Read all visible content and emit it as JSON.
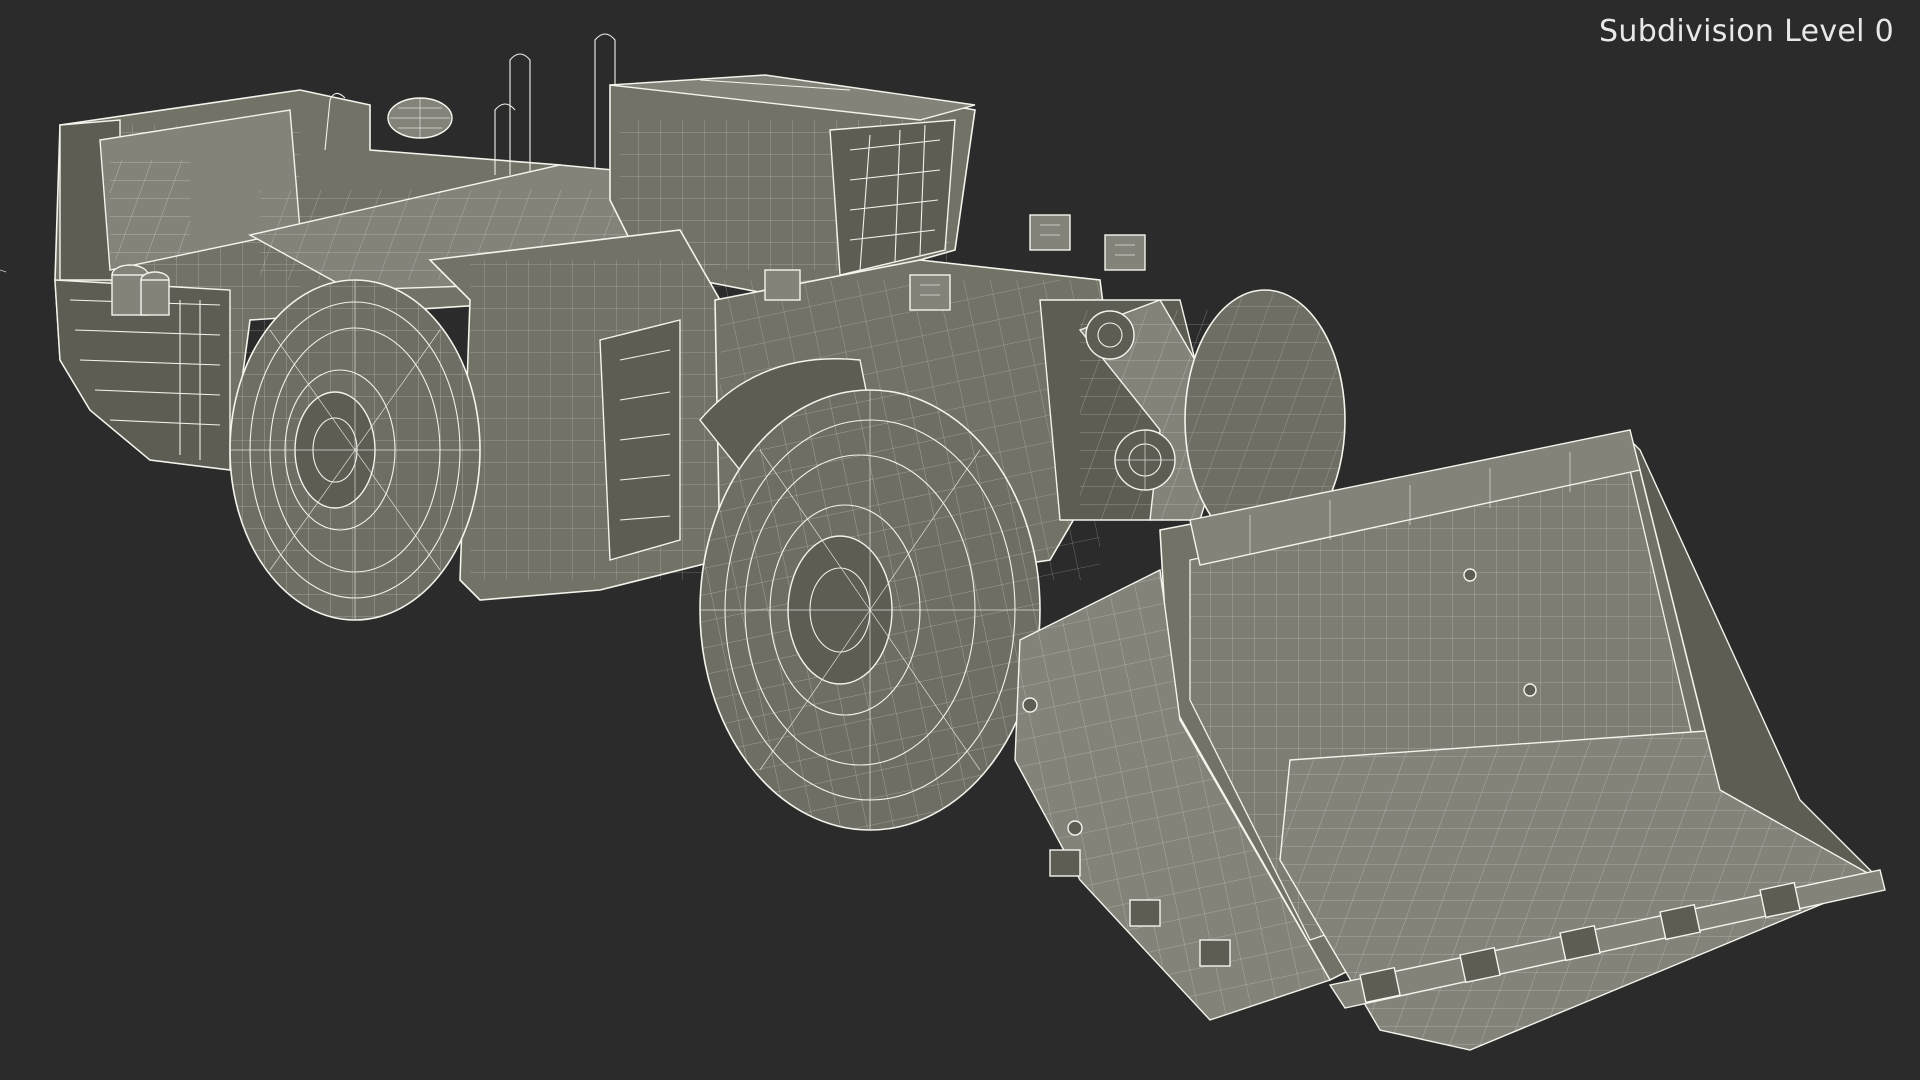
{
  "viewport": {
    "subdivision_label": "Subdivision Level 0",
    "background_color": "#2b2b2b",
    "wireframe_color": "#f2f2ea",
    "model_base_color": "#727267"
  }
}
